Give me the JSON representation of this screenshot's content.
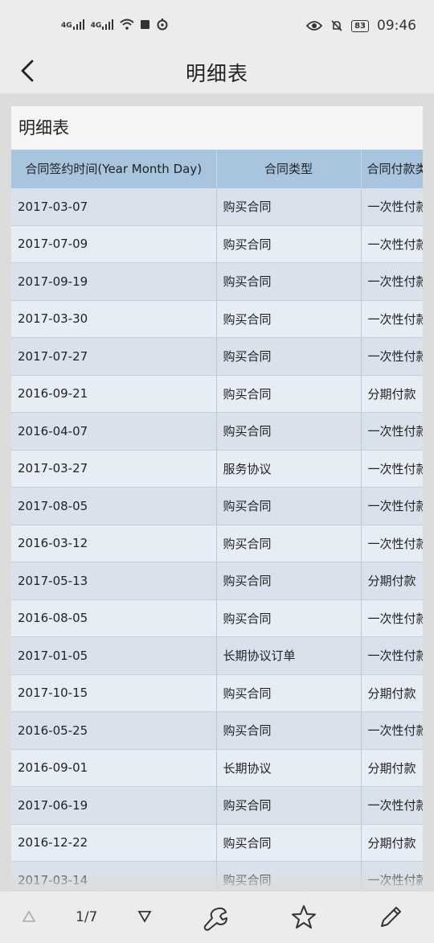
{
  "status_bar": {
    "signal_1": "4G",
    "signal_2": "4G",
    "battery": "83",
    "time": "09:46"
  },
  "header": {
    "title": "明细表"
  },
  "report": {
    "title": "明细表",
    "columns": [
      "合同签约时间(Year Month Day)",
      "合同类型",
      "合同付款类型"
    ],
    "rows": [
      [
        "2017-03-07",
        "购买合同",
        "一次性付款"
      ],
      [
        "2017-07-09",
        "购买合同",
        "一次性付款"
      ],
      [
        "2017-09-19",
        "购买合同",
        "一次性付款"
      ],
      [
        "2017-03-30",
        "购买合同",
        "一次性付款"
      ],
      [
        "2017-07-27",
        "购买合同",
        "一次性付款"
      ],
      [
        "2016-09-21",
        "购买合同",
        "分期付款"
      ],
      [
        "2016-04-07",
        "购买合同",
        "一次性付款"
      ],
      [
        "2017-03-27",
        "服务协议",
        "一次性付款"
      ],
      [
        "2017-08-05",
        "购买合同",
        "一次性付款"
      ],
      [
        "2016-03-12",
        "购买合同",
        "一次性付款"
      ],
      [
        "2017-05-13",
        "购买合同",
        "分期付款"
      ],
      [
        "2016-08-05",
        "购买合同",
        "一次性付款"
      ],
      [
        "2017-01-05",
        "长期协议订单",
        "一次性付款"
      ],
      [
        "2017-10-15",
        "购买合同",
        "分期付款"
      ],
      [
        "2016-05-25",
        "购买合同",
        "一次性付款"
      ],
      [
        "2016-09-01",
        "长期协议",
        "分期付款"
      ],
      [
        "2017-06-19",
        "购买合同",
        "一次性付款"
      ],
      [
        "2016-12-22",
        "购买合同",
        "分期付款"
      ],
      [
        "2017-03-14",
        "购买合同",
        "一次性付款"
      ]
    ]
  },
  "toolbar": {
    "page_indicator": "1/7",
    "icons": [
      "prev-page-icon",
      "next-page-icon",
      "wrench-icon",
      "star-icon",
      "pencil-icon"
    ]
  },
  "colors": {
    "header_row": "#a9c4de",
    "row_odd": "#d9e2ec",
    "row_even": "#e7edf4"
  }
}
